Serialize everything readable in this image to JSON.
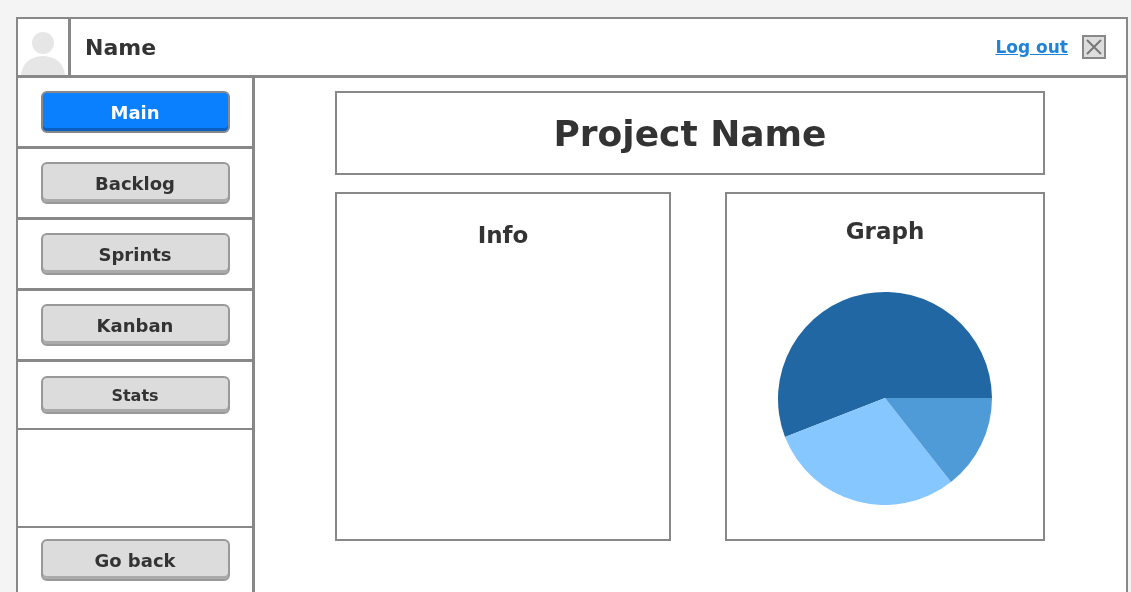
{
  "header": {
    "name": "Name",
    "logout": "Log out"
  },
  "nav": [
    {
      "label": "Main",
      "selected": true
    },
    {
      "label": "Backlog",
      "selected": false
    },
    {
      "label": "Sprints",
      "selected": false
    },
    {
      "label": "Kanban",
      "selected": false
    },
    {
      "label": "Stats",
      "selected": false
    }
  ],
  "footer_button": "Go back",
  "project_title": "Project Name",
  "panels": [
    {
      "title": "Info",
      "kind": "text"
    },
    {
      "title": "Graph",
      "kind": "pie"
    }
  ]
}
